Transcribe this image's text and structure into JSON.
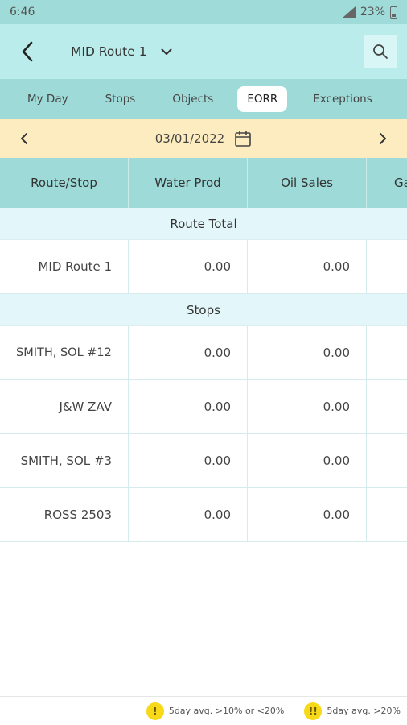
{
  "status_bar": {
    "time": "6:46",
    "battery": "23%"
  },
  "app_bar": {
    "route_title": "MID Route 1"
  },
  "tabs": [
    {
      "label": "My Day",
      "active": false
    },
    {
      "label": "Stops",
      "active": false
    },
    {
      "label": "Objects",
      "active": false
    },
    {
      "label": "EORR",
      "active": true
    },
    {
      "label": "Exceptions",
      "active": false
    }
  ],
  "date_bar": {
    "date": "03/01/2022"
  },
  "table": {
    "columns": [
      "Route/Stop",
      "Water Prod",
      "Oil Sales",
      "Ga"
    ],
    "route_total_label": "Route Total",
    "route_total_row": {
      "name": "MID Route 1",
      "water_prod": "0.00",
      "oil_sales": "0.00"
    },
    "stops_label": "Stops",
    "stops": [
      {
        "name": "SMITH, SOL #12",
        "water_prod": "0.00",
        "oil_sales": "0.00"
      },
      {
        "name": "J&W ZAV",
        "water_prod": "0.00",
        "oil_sales": "0.00"
      },
      {
        "name": "SMITH, SOL #3",
        "water_prod": "0.00",
        "oil_sales": "0.00"
      },
      {
        "name": "ROSS 2503",
        "water_prod": "0.00",
        "oil_sales": "0.00"
      }
    ]
  },
  "legend": {
    "item1": {
      "icon": "!",
      "label": "5day avg. >10% or <20%"
    },
    "item2": {
      "icon": "!!",
      "label": "5day avg. >20%"
    }
  },
  "colors": {
    "header_teal": "#b9ecea",
    "tab_teal": "#9edad7",
    "date_bar": "#fdecc0",
    "warning_yellow": "#f7d91a"
  }
}
